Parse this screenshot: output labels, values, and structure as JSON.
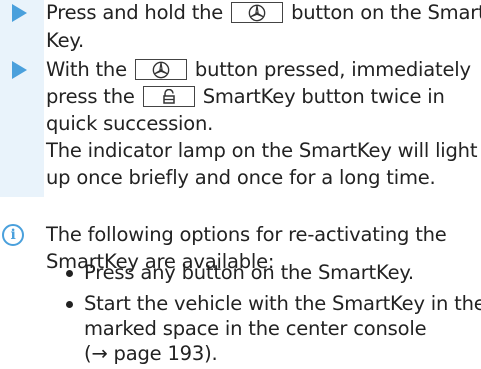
{
  "steps": [
    {
      "lines": [
        "Press and hold the",
        "button on the Smart-",
        "Key."
      ],
      "button_icon": "mercedes-star-icon"
    },
    {
      "lines": [
        "With the",
        "button pressed, immediately",
        "press the",
        "SmartKey button twice in",
        "quick succession.",
        "The indicator lamp on the SmartKey will light",
        "up once briefly and once for a long time."
      ],
      "button_icons": [
        "mercedes-star-icon",
        "lock-icon"
      ]
    }
  ],
  "info": {
    "icon": "info-icon",
    "glyph": "i",
    "lines": [
      "The following options for re-activating the",
      "SmartKey are available:"
    ]
  },
  "bullets": [
    {
      "lines": [
        "Press any button on the SmartKey."
      ]
    },
    {
      "lines": [
        "Start the vehicle with the SmartKey in the",
        "marked space in the center console",
        "(→ page 193)."
      ]
    }
  ],
  "colors": {
    "accent": "#4aa0dc",
    "step_background": "#e9f3fb",
    "text": "#222222"
  }
}
